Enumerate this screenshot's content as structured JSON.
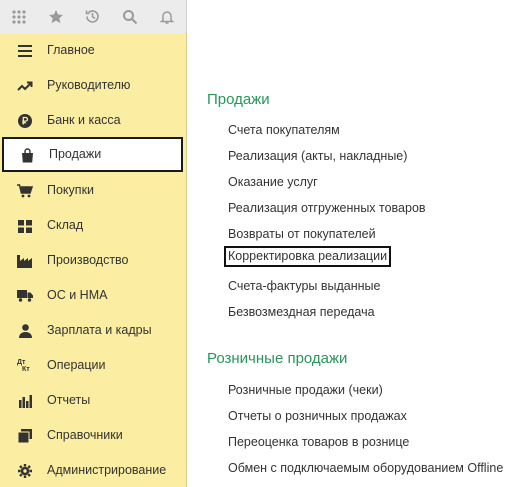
{
  "toolbar": {
    "icons": [
      "apps-grid-icon",
      "star-icon",
      "history-icon",
      "search-icon",
      "bell-icon"
    ]
  },
  "sidebar": {
    "items": [
      {
        "label": "Главное",
        "icon": "menu-lines-icon"
      },
      {
        "label": "Руководителю",
        "icon": "trend-icon"
      },
      {
        "label": "Банк и касса",
        "icon": "ruble-coin-icon"
      },
      {
        "label": "Продажи",
        "icon": "shopping-bag-icon",
        "active": true
      },
      {
        "label": "Покупки",
        "icon": "cart-icon"
      },
      {
        "label": "Склад",
        "icon": "warehouse-grid-icon"
      },
      {
        "label": "Производство",
        "icon": "factory-icon"
      },
      {
        "label": "ОС и НМА",
        "icon": "truck-icon"
      },
      {
        "label": "Зарплата и кадры",
        "icon": "person-icon"
      },
      {
        "label": "Операции",
        "icon": "dt-kt-icon"
      },
      {
        "label": "Отчеты",
        "icon": "bar-chart-icon"
      },
      {
        "label": "Справочники",
        "icon": "books-icon"
      },
      {
        "label": "Администрирование",
        "icon": "gear-icon"
      }
    ],
    "dt_kt": {
      "dt": "Дт",
      "kt": "Кт"
    }
  },
  "main": {
    "sections": [
      {
        "title": "Продажи",
        "links": [
          "Счета покупателям",
          "Реализация (акты, накладные)",
          "Оказание услуг",
          "Реализация отгруженных товаров",
          "Возвраты от покупателей",
          "Корректировка реализации",
          "Счета-фактуры выданные",
          "Безвозмездная передача"
        ]
      },
      {
        "title": "Розничные продажи",
        "links": [
          "Розничные продажи (чеки)",
          "Отчеты о розничных продажах",
          "Переоценка товаров в рознице",
          "Обмен с подключаемым оборудованием Offline"
        ]
      }
    ]
  },
  "colors": {
    "sidebar_bg": "#fbeda1",
    "section_title": "#28965a",
    "toolbar_bg": "#ececec"
  }
}
